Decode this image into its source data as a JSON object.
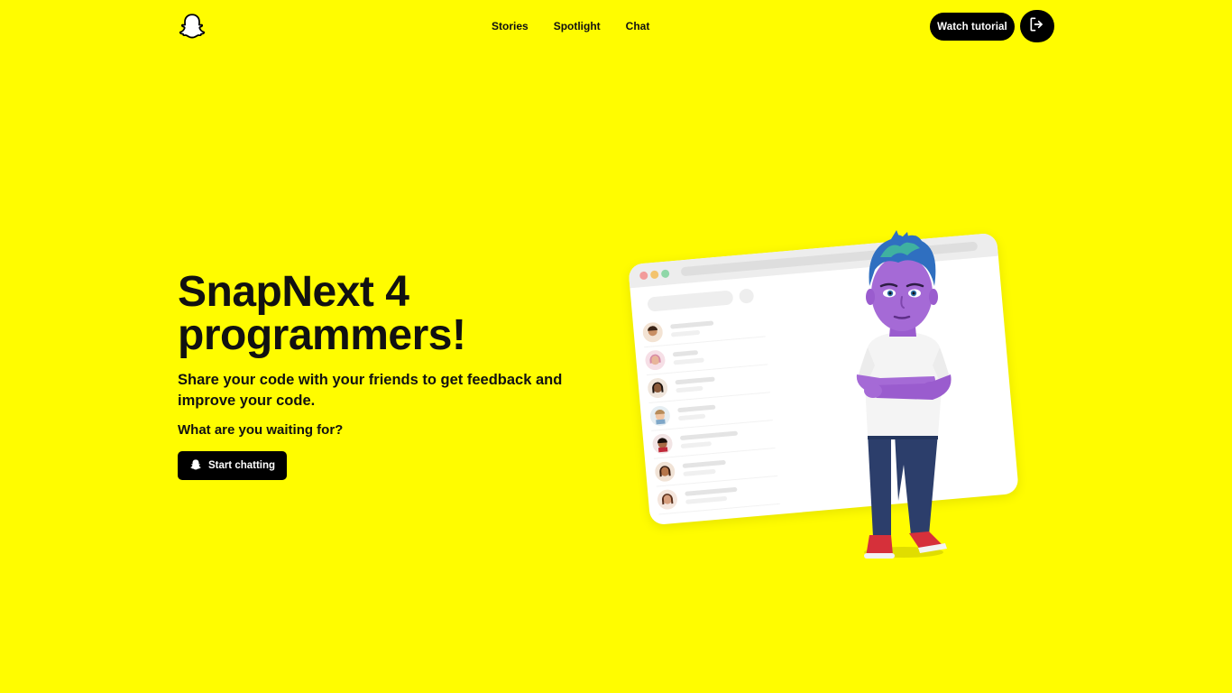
{
  "header": {
    "logo_icon": "snapchat-ghost-icon",
    "nav": [
      {
        "label": "Stories"
      },
      {
        "label": "Spotlight"
      },
      {
        "label": "Chat"
      }
    ],
    "watch_tutorial_label": "Watch tutorial",
    "logout_icon": "logout-icon"
  },
  "hero": {
    "title": "SnapNext 4 programmers!",
    "subtitle": "Share your code with your friends to get feedback and improve your code.",
    "question": "What are you waiting for?",
    "cta_label": "Start chatting",
    "cta_icon": "snapchat-ghost-icon"
  },
  "illustration": {
    "description_icon": "chat-window-illustration",
    "character_icon": "bitmoji-avatar"
  },
  "colors": {
    "background": "#FFFC00",
    "button": "#000000",
    "button_text": "#FFFFFF"
  }
}
